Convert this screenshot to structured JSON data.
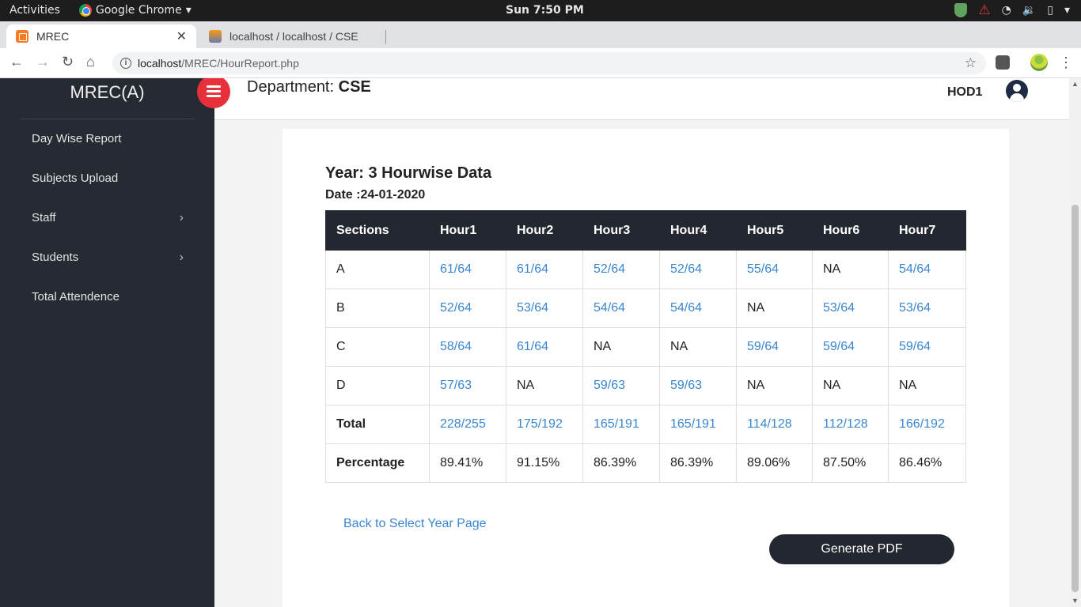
{
  "os_bar": {
    "activities": "Activities",
    "app_name": "Google Chrome",
    "app_menu_arrow": "▾",
    "clock": "Sun  7:50 PM",
    "power_arrow": "▾"
  },
  "browser": {
    "tabs": [
      {
        "title": "MREC",
        "active": true
      },
      {
        "title": "localhost / localhost / CSE",
        "active": false
      }
    ],
    "url_host": "localhost",
    "url_path": "/MREC/HourReport.php"
  },
  "sidebar": {
    "brand": "MREC(A)",
    "items": [
      {
        "label": "Day Wise Report",
        "has_submenu": false
      },
      {
        "label": "Subjects Upload",
        "has_submenu": false
      },
      {
        "label": "Staff",
        "has_submenu": true
      },
      {
        "label": "Students",
        "has_submenu": true
      },
      {
        "label": "Total Attendence",
        "has_submenu": false
      }
    ]
  },
  "header": {
    "department_label": "Department:",
    "department_value": "CSE",
    "user": "HOD1"
  },
  "report": {
    "title": "Year: 3 Hourwise Data",
    "date": "Date :24-01-2020",
    "columns": [
      "Sections",
      "Hour1",
      "Hour2",
      "Hour3",
      "Hour4",
      "Hour5",
      "Hour6",
      "Hour7"
    ],
    "rows": [
      {
        "label": "A",
        "cells": [
          "61/64",
          "61/64",
          "52/64",
          "52/64",
          "55/64",
          "NA",
          "54/64"
        ]
      },
      {
        "label": "B",
        "cells": [
          "52/64",
          "53/64",
          "54/64",
          "54/64",
          "NA",
          "53/64",
          "53/64"
        ]
      },
      {
        "label": "C",
        "cells": [
          "58/64",
          "61/64",
          "NA",
          "NA",
          "59/64",
          "59/64",
          "59/64"
        ]
      },
      {
        "label": "D",
        "cells": [
          "57/63",
          "NA",
          "59/63",
          "59/63",
          "NA",
          "NA",
          "NA"
        ]
      },
      {
        "label": "Total",
        "cells": [
          "228/255",
          "175/192",
          "165/191",
          "165/191",
          "114/128",
          "112/128",
          "166/192"
        ]
      },
      {
        "label": "Percentage",
        "cells": [
          "89.41%",
          "91.15%",
          "86.39%",
          "86.39%",
          "89.06%",
          "87.50%",
          "86.46%"
        ]
      }
    ],
    "back_link": "Back to Select Year Page",
    "pdf_button": "Generate PDF"
  },
  "colors": {
    "sidebar_bg": "#262a33",
    "accent_red": "#e8303a",
    "link_blue": "#3a86cf",
    "table_header_bg": "#23272f"
  }
}
